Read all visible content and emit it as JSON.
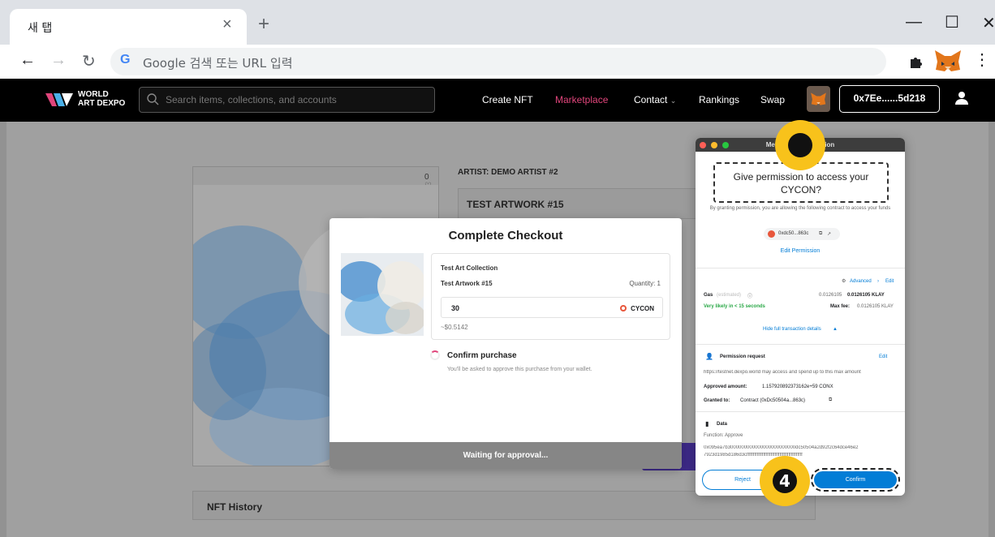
{
  "browser": {
    "tab_title": "새 탭",
    "tab_close": "×",
    "new_tab": "+",
    "win_min": "—",
    "win_max": "☐",
    "win_close": "✕",
    "omnibox_placeholder": "Google 검색 또는 URL 입력",
    "google_g": "G"
  },
  "site": {
    "logo_line1": "WORLD",
    "logo_line2": "ART DEXPO",
    "search_placeholder": "Search items, collections, and accounts",
    "nav": [
      "Create NFT",
      "Marketplace",
      "Contact",
      "Rankings",
      "Swap"
    ],
    "contact_chevron": "⌄",
    "address": "0x7Ee......5d218",
    "accent": "#e0457b"
  },
  "artwork": {
    "likes": "0 ♡",
    "artist": "ARTIST: DEMO ARTIST #2",
    "title": "TEST ARTWORK #15",
    "history": "NFT History"
  },
  "checkout": {
    "title": "Complete Checkout",
    "collection": "Test Art Collection",
    "artwork": "Test Artwork #15",
    "quantity": "Quantity: 1",
    "amount": "30",
    "currency": "CYCON",
    "usd": "~$0.5142",
    "confirm_title": "Confirm purchase",
    "confirm_sub": "You'll be asked to approve this purchase from your wallet.",
    "waiting": "Waiting for approval..."
  },
  "metamask": {
    "window_title": "MetaMask Notification",
    "permission_line1": "Give permission to access your",
    "permission_line2": "CYCON?",
    "granting": "By granting permission, you are allowing the following contract to access your funds",
    "contract_chip": "0xdc50...863c",
    "edit_permission": "Edit Permission",
    "advanced": "Advanced",
    "edit": "Edit",
    "gas_label": "Gas",
    "gas_estimated": "(estimated)",
    "gas_value_grey": "0.0126105",
    "gas_value": "0.0126105 KLAY",
    "likely": "Very likely in < 15 seconds",
    "max_fee_label": "Max fee:",
    "max_fee": "0.0126105 KLAY",
    "hide_details": "Hide full transaction details",
    "perm_request": "Permission request",
    "perm_edit": "Edit",
    "perm_desc": "https://testnet.dexpo.world may access and spend up to this max amount",
    "approved_label": "Approved amount:",
    "approved_value": "1.157920892373162e+59 CONX",
    "granted_label": "Granted to:",
    "granted_value": "Contract (0xDc50504a...863c)",
    "data_title": "Data",
    "function": "Function: Approve",
    "hex1": "0x095ea7b3000000000000000000000000dc50504a2d92f2c64dce46e2",
    "hex2": "7923d1985d186d3cffffffffffffffffffffffffffffffffffffffffffff",
    "reject": "Reject",
    "confirm": "Confirm"
  },
  "annotations": {
    "step_number": "4",
    "highlight_color": "#f8c21b"
  }
}
